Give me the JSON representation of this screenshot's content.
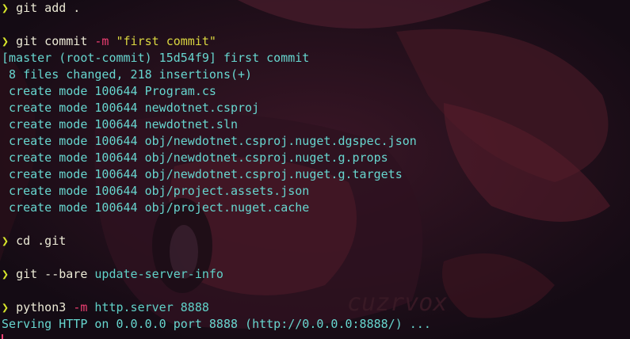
{
  "prompt_symbol": "❯",
  "colors": {
    "background": "#150d16",
    "prompt": "#d7e62a",
    "command": "#ecead6",
    "flag": "#ef3f73",
    "string": "#d9d640",
    "output": "#67d6cf"
  },
  "commands": {
    "git_add": {
      "cmd": "git add ."
    },
    "git_commit": {
      "cmd": "git commit ",
      "flag": "-m",
      "message": "\"first commit\""
    },
    "cd": {
      "cmd": "cd .git"
    },
    "git_bare": {
      "cmd": "git --bare ",
      "arg": "update-server-info"
    },
    "python": {
      "cmd": "python3 ",
      "flag": "-m",
      "arg": "http.server 8888"
    }
  },
  "commit_output": [
    "[master (root-commit) 15d54f9] first commit",
    " 8 files changed, 218 insertions(+)",
    " create mode 100644 Program.cs",
    " create mode 100644 newdotnet.csproj",
    " create mode 100644 newdotnet.sln",
    " create mode 100644 obj/newdotnet.csproj.nuget.dgspec.json",
    " create mode 100644 obj/newdotnet.csproj.nuget.g.props",
    " create mode 100644 obj/newdotnet.csproj.nuget.g.targets",
    " create mode 100644 obj/project.assets.json",
    " create mode 100644 obj/project.nuget.cache"
  ],
  "server_output": "Serving HTTP on 0.0.0.0 port 8888 (http://0.0.0.0:8888/) ..."
}
